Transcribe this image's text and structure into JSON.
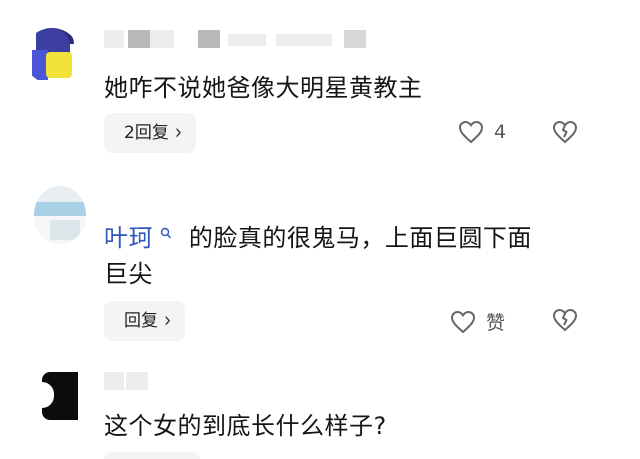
{
  "comments": [
    {
      "text": "她咋不说她爸像大明星黄教主",
      "reply_button": "2回复",
      "like_count": "4"
    },
    {
      "mention": "叶珂",
      "mention_icon": "search-icon",
      "text_line1": "的脸真的很鬼马，上面巨圆下面",
      "text_line2": "巨尖",
      "reply_button": "回复",
      "like_label": "赞"
    },
    {
      "text": "这个女的到底长什么样子?"
    }
  ],
  "icons": {
    "like": "heart-outline-icon",
    "dislike": "broken-heart-icon",
    "chevron": "chevron-right-icon"
  },
  "colors": {
    "mention": "#2e57b8",
    "pill_bg": "#f3f4f5"
  }
}
